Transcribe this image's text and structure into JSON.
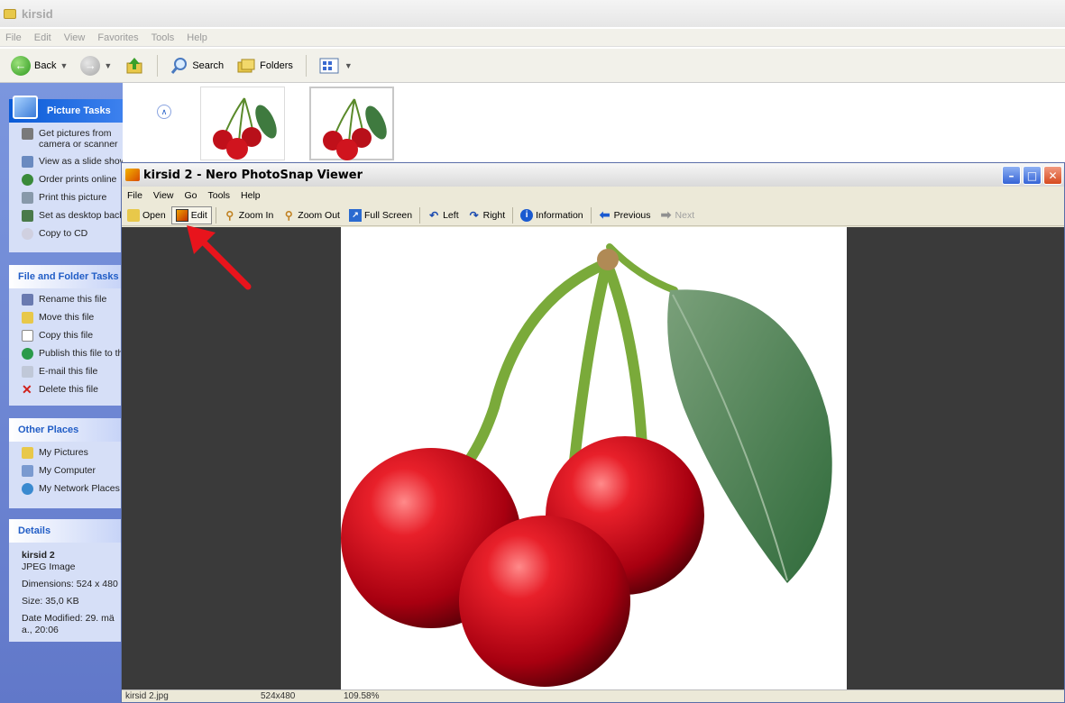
{
  "explorer": {
    "title": "kirsid",
    "menu": [
      "File",
      "Edit",
      "View",
      "Favorites",
      "Tools",
      "Help"
    ],
    "toolbar": {
      "back": "Back",
      "search": "Search",
      "folders": "Folders"
    },
    "picture_tasks": {
      "header": "Picture Tasks",
      "items": [
        "Get pictures from camera or scanner",
        "View as a slide show",
        "Order prints online",
        "Print this picture",
        "Set as desktop background",
        "Copy to CD"
      ]
    },
    "file_tasks": {
      "header": "File and Folder Tasks",
      "items": [
        "Rename this file",
        "Move this file",
        "Copy this file",
        "Publish this file to the Web",
        "E-mail this file",
        "Delete this file"
      ]
    },
    "other_places": {
      "header": "Other Places",
      "items": [
        "My Pictures",
        "My Computer",
        "My Network Places"
      ]
    },
    "details": {
      "header": "Details",
      "name": "kirsid 2",
      "type": "JPEG Image",
      "dimensions": "Dimensions: 524 x 480",
      "size": "Size: 35,0 KB",
      "modified": "Date Modified: 29. mä a., 20:06"
    }
  },
  "viewer": {
    "title": "kirsid 2 - Nero PhotoSnap Viewer",
    "menu": [
      "File",
      "View",
      "Go",
      "Tools",
      "Help"
    ],
    "toolbar": {
      "open": "Open",
      "edit": "Edit",
      "zoom_in": "Zoom In",
      "zoom_out": "Zoom Out",
      "full_screen": "Full Screen",
      "left": "Left",
      "right": "Right",
      "information": "Information",
      "previous": "Previous",
      "next": "Next"
    },
    "status": {
      "filename": "kirsid 2.jpg",
      "dimensions": "524x480",
      "zoom": "109.58%"
    }
  },
  "colors": {
    "accent_red": "#e8141c",
    "viewer_bg": "#3a3a3a",
    "task_pane": "#d6dff7"
  }
}
